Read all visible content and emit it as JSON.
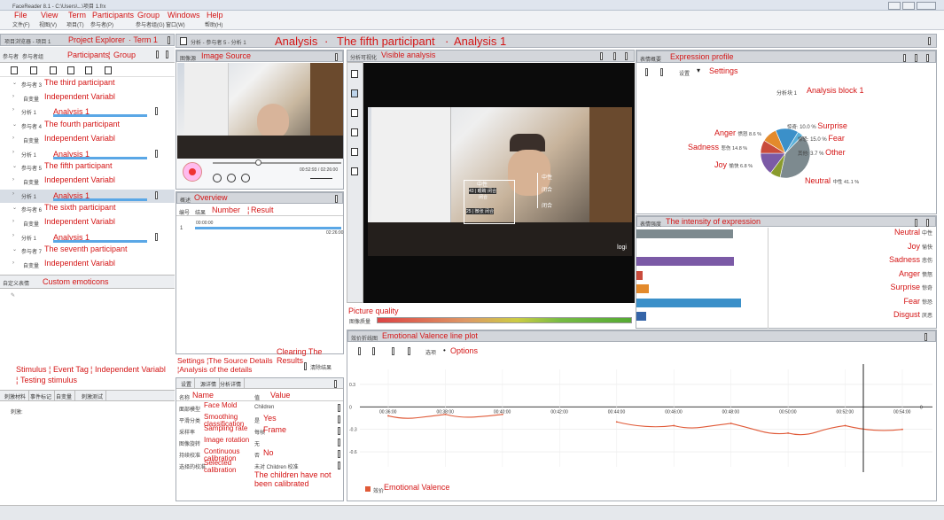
{
  "window": {
    "title": "FaceReader 8.1 - C:\\Users\\...\\项目 1.frx"
  },
  "menu": [
    {
      "en": "File",
      "cn": "文件(F)"
    },
    {
      "en": "View",
      "cn": "视图(V)"
    },
    {
      "en": "Term",
      "cn": "项目(T)"
    },
    {
      "en": "Participants",
      "cn": "参与者(P)"
    },
    {
      "en": "Group",
      "cn": "参与者组(G)"
    },
    {
      "en": "Windows",
      "cn": "窗口(W)"
    },
    {
      "en": "Help",
      "cn": "帮助(H)"
    }
  ],
  "explorer": {
    "title_cn": "项目浏览器 - 项目 1",
    "title_en": "Project Explorer",
    "term": "· Term 1",
    "tab1_cn": "参与者",
    "tab2_cn": "参与者组",
    "participants": "Participants",
    "group": "Group",
    "rows": [
      {
        "cn": "参与者 3",
        "en": "The third participant"
      },
      {
        "cn": "自变量",
        "en": "Independent Variabl"
      },
      {
        "cn": "分析 1",
        "en": "Analysis 1"
      },
      {
        "cn": "参与者 4",
        "en": "The fourth participant"
      },
      {
        "cn": "自变量",
        "en": "Independent Variabl"
      },
      {
        "cn": "分析 1",
        "en": "Analysis 1"
      },
      {
        "cn": "参与者 5",
        "en": "The fifth participant"
      },
      {
        "cn": "自变量",
        "en": "Independent Variabl"
      },
      {
        "cn": "分析 1",
        "en": "Analysis 1"
      },
      {
        "cn": "参与者 6",
        "en": "The sixth participant"
      },
      {
        "cn": "自变量",
        "en": "Independent Variabl"
      },
      {
        "cn": "分析 1",
        "en": "Analysis 1"
      },
      {
        "cn": "参与者 7",
        "en": "The seventh participant"
      },
      {
        "cn": "自变量",
        "en": "Independent Variabl"
      }
    ]
  },
  "custom": {
    "cn": "自定义表情",
    "en": "Custom emoticons"
  },
  "stimulus": {
    "label1": "Stimulus",
    "label2": "Event Tag",
    "label3": "Independent Variabl",
    "label4": "Testing stimulus",
    "tabs": [
      "刺激材料",
      "事件标记",
      "自变量",
      "刺激测试"
    ],
    "row_cn": "刺激:"
  },
  "analysis_header": {
    "cn": "分析 - 参与者 5 - 分析 1",
    "en": "Analysis",
    "sep1": "·",
    "participant": "The fifth participant",
    "sep2": "·",
    "analysis": "Analysis 1"
  },
  "image_source": {
    "cn": "图像源",
    "en": "Image Source",
    "time": "00:52:93 / 02:26:00"
  },
  "overview": {
    "cn": "概述",
    "en": "Overview",
    "col1": "编号",
    "col2": "结果",
    "number": "Number",
    "result": "Result",
    "row_num": "1",
    "row_start": "00:00:00",
    "row_end": "02:26:00"
  },
  "settings": {
    "labels": "Settings ¦The Source Details ¦Analysis of the details",
    "clearing": "Clearing The Results",
    "clear_btn": "清除结果",
    "tabs": [
      "设置",
      "源详情",
      "分析详情"
    ],
    "name_cn": "名称",
    "name_en": "Name",
    "value_cn": "值",
    "value_en": "Value",
    "rows": [
      {
        "cn": "面部模型",
        "en": "Face Mold",
        "value": "Children",
        "value_en": ""
      },
      {
        "cn": "平滑分类",
        "en": "Smoothing classification",
        "value": "是",
        "value_en": "Yes"
      },
      {
        "cn": "采样率",
        "en": "Sampling rate",
        "value": "每帧",
        "value_en": "Frame"
      },
      {
        "cn": "图像旋转",
        "en": "Image rotation",
        "value": "无",
        "value_en": ""
      },
      {
        "cn": "持续校准",
        "en": "Continuous calibration",
        "value": "否",
        "value_en": "No"
      },
      {
        "cn": "选择的校准",
        "en": "Selected calibration",
        "value": "未对 Children 校准",
        "value_en": "The children have not been calibrated"
      }
    ]
  },
  "visible": {
    "cn": "分析可视化",
    "en": "Visible analysis",
    "tags": {
      "t1": "中性",
      "t2": "43 | 眼睛 闭合",
      "t3": "闭合",
      "t4": "25 | 微张 闭合",
      "t5": "闭合",
      "t6": "闭合"
    }
  },
  "quality": {
    "en": "Picture quality",
    "cn": "图像质量"
  },
  "expression_profile": {
    "cn": "表情概要",
    "en": "Expression profile",
    "settings_cn": "设置",
    "settings_en": "Settings",
    "block_cn": "分析块 1",
    "block_en": "Analysis block 1",
    "slices": [
      {
        "en": "Neutral",
        "cn": "中性",
        "pct": "41.1 %",
        "value": 41.1,
        "color": "#7d8a8f"
      },
      {
        "en": "Joy",
        "cn": "愉快",
        "pct": "6.8 %",
        "value": 6.8,
        "color": "#8a9b2e"
      },
      {
        "en": "Sadness",
        "cn": "悲伤",
        "pct": "14.8 %",
        "value": 14.8,
        "color": "#7b5aa6"
      },
      {
        "en": "Anger",
        "cn": "愤怒",
        "pct": "8.6 %",
        "value": 8.6,
        "color": "#c94b3c"
      },
      {
        "en": "Surprise",
        "cn": "惊奇",
        "pct": "10.0 %",
        "value": 10.0,
        "color": "#e38a2c"
      },
      {
        "en": "Fear",
        "cn": "惊恐",
        "pct": "15.0 %",
        "value": 15.0,
        "color": "#3b90c9"
      },
      {
        "en": "Other",
        "cn": "其他",
        "pct": "3.7 %",
        "value": 3.7,
        "color": "#5bb0d8"
      }
    ]
  },
  "intensity": {
    "cn": "表情强度",
    "en": "The intensity of expression",
    "rows": [
      {
        "en": "Neutral",
        "cn": "中性",
        "value": 0.92,
        "color": "#7d8a8f"
      },
      {
        "en": "Joy",
        "cn": "愉快",
        "value": 0.0,
        "color": "#8a9b2e"
      },
      {
        "en": "Sadness",
        "cn": "悲伤",
        "value": 0.93,
        "color": "#7b5aa6"
      },
      {
        "en": "Anger",
        "cn": "愤怒",
        "value": 0.06,
        "color": "#c94b3c"
      },
      {
        "en": "Surprise",
        "cn": "惊奇",
        "value": 0.12,
        "color": "#e38a2c"
      },
      {
        "en": "Fear",
        "cn": "惊恐",
        "value": 1.0,
        "color": "#3b90c9"
      },
      {
        "en": "Disgust",
        "cn": "厌恶",
        "value": 0.09,
        "color": "#3565a8"
      }
    ]
  },
  "valence": {
    "cn": "效价折线图",
    "en": "Emotional  Valence line plot",
    "select_cn": "选项",
    "options": "Options",
    "legend_cn": "效价",
    "legend_en": "Emotional Valence",
    "yticks": [
      "0.3",
      "0",
      "-0.3",
      "-0.6"
    ],
    "xticks": [
      "00:36:00",
      "00:38:00",
      "00:40:00",
      "00:42:00",
      "00:44:00",
      "00:46:00",
      "00:48:00",
      "00:50:00",
      "00:52:00",
      "00:54:00"
    ]
  },
  "chart_data": {
    "type": "line",
    "ylim": [
      -0.8,
      0.5
    ],
    "x": [
      "00:36:00",
      "00:38:00",
      "00:40:00",
      "00:42:00",
      "00:44:00",
      "00:46:00",
      "00:48:00",
      "00:50:00",
      "00:52:00",
      "00:54:00"
    ],
    "series": [
      {
        "name": "Emotional Valence",
        "values": [
          -0.12,
          -0.1,
          -0.1,
          null,
          -0.2,
          -0.25,
          -0.22,
          -0.35,
          -0.25,
          -0.3
        ]
      }
    ]
  }
}
